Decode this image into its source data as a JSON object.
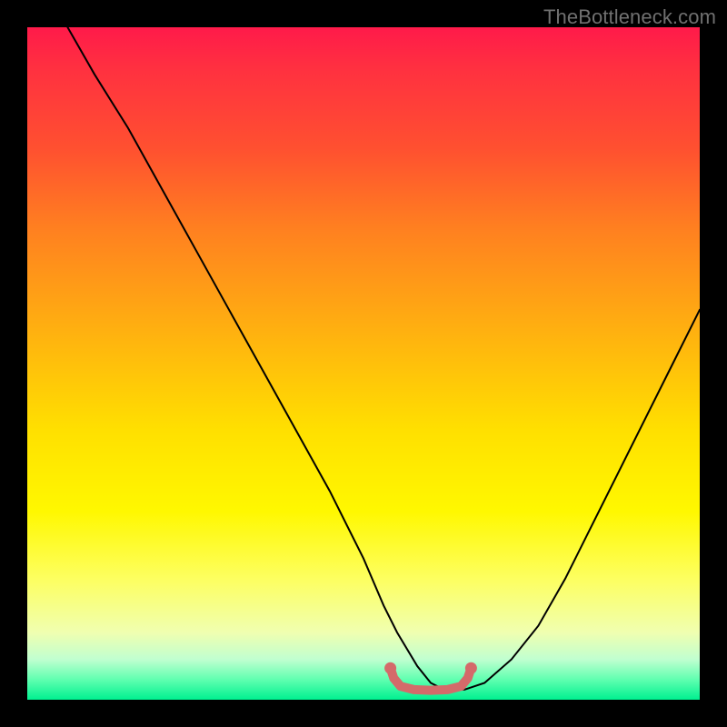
{
  "watermark": "TheBottleneck.com",
  "chart_data": {
    "type": "line",
    "title": "",
    "xlabel": "",
    "ylabel": "",
    "xlim": [
      0,
      100
    ],
    "ylim": [
      0,
      100
    ],
    "series": [
      {
        "name": "bottleneck-curve",
        "x_pct": [
          6,
          10,
          15,
          20,
          25,
          30,
          35,
          40,
          45,
          50,
          53,
          55,
          58,
          60,
          62,
          65,
          68,
          72,
          76,
          80,
          84,
          88,
          92,
          96,
          100
        ],
        "y_pct": [
          100,
          93,
          85,
          76,
          67,
          58,
          49,
          40,
          31,
          21,
          14,
          10,
          5,
          2.5,
          1.5,
          1.5,
          2.5,
          6,
          11,
          18,
          26,
          34,
          42,
          50,
          58
        ],
        "stroke": "#000000",
        "stroke_width": 2
      },
      {
        "name": "sweet-spot-marker",
        "x_pct": [
          54.0,
          54.5,
          55.5,
          57.5,
          60.0,
          62.5,
          64.5,
          65.5,
          66.0
        ],
        "y_pct": [
          4.7,
          3.2,
          2.0,
          1.5,
          1.4,
          1.5,
          2.0,
          3.2,
          4.7
        ],
        "stroke": "#d46a6a",
        "stroke_width": 10
      }
    ],
    "background_gradient": {
      "type": "vertical-linear",
      "stops": [
        {
          "pct": 0,
          "color": "#ff1a4a"
        },
        {
          "pct": 6,
          "color": "#ff3040"
        },
        {
          "pct": 18,
          "color": "#ff5030"
        },
        {
          "pct": 30,
          "color": "#ff8020"
        },
        {
          "pct": 45,
          "color": "#ffb010"
        },
        {
          "pct": 60,
          "color": "#ffe000"
        },
        {
          "pct": 72,
          "color": "#fff800"
        },
        {
          "pct": 82,
          "color": "#fdff60"
        },
        {
          "pct": 90,
          "color": "#f0ffb0"
        },
        {
          "pct": 94,
          "color": "#c0ffd0"
        },
        {
          "pct": 97,
          "color": "#60ffb0"
        },
        {
          "pct": 100,
          "color": "#00f090"
        }
      ]
    }
  }
}
